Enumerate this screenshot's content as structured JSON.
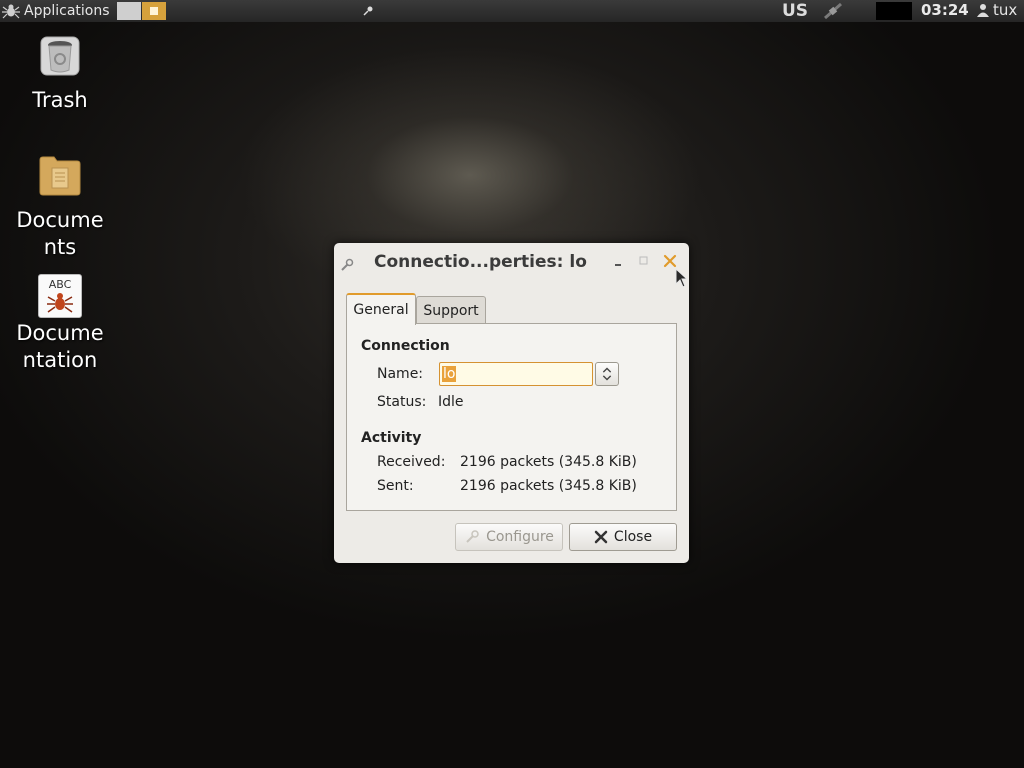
{
  "panel": {
    "applications_label": "Applications",
    "keyboard_layout": "US",
    "clock": "03:24",
    "user": "tux"
  },
  "desktop": {
    "icons": [
      {
        "label": "Trash"
      },
      {
        "label_line1": "Docume",
        "label_line2": "nts"
      },
      {
        "label_line1": "Docume",
        "label_line2": "ntation",
        "badge": "ABC"
      }
    ]
  },
  "dialog": {
    "title": "Connectio...perties: lo",
    "tabs": [
      {
        "label": "General"
      },
      {
        "label": "Support"
      }
    ],
    "connection_heading": "Connection",
    "name_label": "Name:",
    "name_value": "lo",
    "status_label": "Status:",
    "status_value": "Idle",
    "activity_heading": "Activity",
    "received_label": "Received:",
    "received_value": "2196 packets (345.8 KiB)",
    "sent_label": "Sent:",
    "sent_value": "2196 packets (345.8 KiB)",
    "configure_label": "Configure",
    "close_label": "Close"
  },
  "colors": {
    "accent": "#e19b2c",
    "panel_bg": "#2e2e2e",
    "dialog_bg": "#edebe7"
  },
  "icons": [
    "spider-logo-icon",
    "pin-icon",
    "network-icon",
    "user-icon",
    "trash-icon",
    "folder-icon",
    "spider-doc-icon",
    "wrench-icon",
    "minimize-icon",
    "maximize-icon",
    "close-icon",
    "spin-arrows-icon",
    "configure-icon",
    "close-x-icon",
    "mouse-cursor-icon"
  ]
}
